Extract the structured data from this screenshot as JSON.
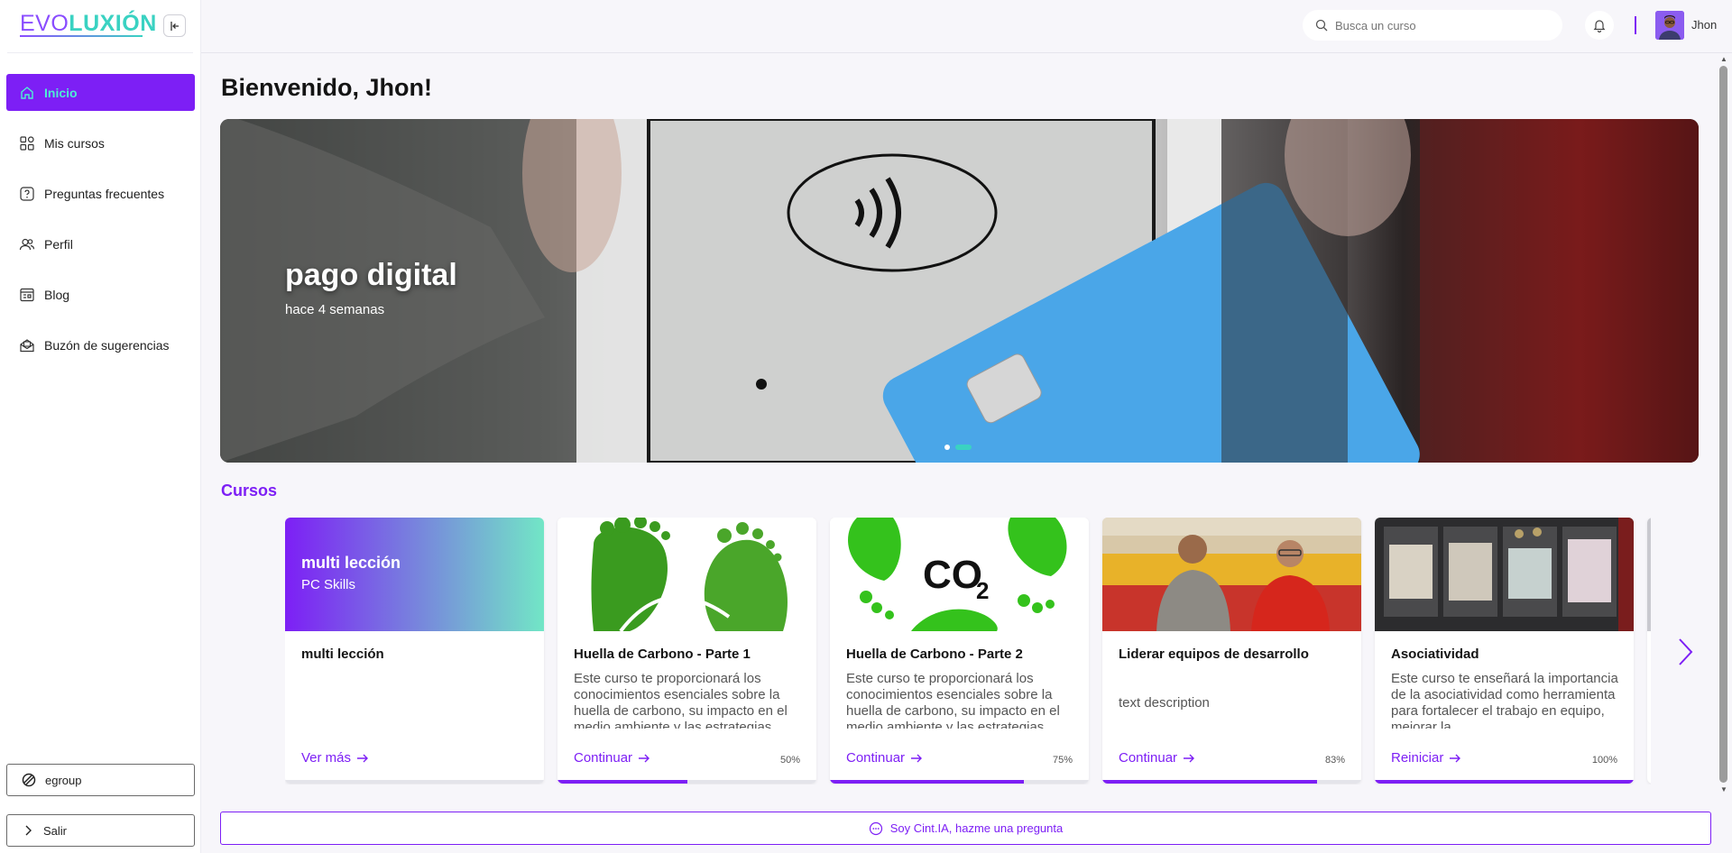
{
  "brand": {
    "logo_part1": "EVO",
    "logo_part2": "LUXIÓN"
  },
  "sidebar": {
    "items": [
      {
        "label": "Inicio",
        "icon": "home-icon",
        "active": true
      },
      {
        "label": "Mis cursos",
        "icon": "grid-icon"
      },
      {
        "label": "Preguntas frecuentes",
        "icon": "question-icon"
      },
      {
        "label": "Perfil",
        "icon": "users-icon"
      },
      {
        "label": "Blog",
        "icon": "blog-icon"
      },
      {
        "label": "Buzón de sugerencias",
        "icon": "mailbox-icon"
      }
    ],
    "org_label": "egroup",
    "logout_label": "Salir"
  },
  "header": {
    "search_placeholder": "Busca un curso",
    "user_name": "Jhon"
  },
  "main": {
    "welcome": "Bienvenido, Jhon!",
    "hero": {
      "title": "pago digital",
      "subtitle": "hace 4 semanas",
      "slides": 2,
      "active_slide": 2
    },
    "courses_title": "Cursos",
    "courses": [
      {
        "cover_title": "multi lección",
        "cover_subtitle": "PC Skills",
        "title": "multi lección",
        "description": "",
        "action": "Ver más",
        "progress": null
      },
      {
        "title": "Huella de Carbono - Parte 1",
        "description": "Este curso te proporcionará los conocimientos esenciales sobre la huella de carbono, su impacto en el medio ambiente y las estrategias",
        "action": "Continuar",
        "progress_label": "50%",
        "progress": 0.5
      },
      {
        "title": "Huella de Carbono - Parte 2",
        "description": "Este curso te proporcionará los conocimientos esenciales sobre la huella de carbono, su impacto en el medio ambiente y las estrategias",
        "action": "Continuar",
        "progress_label": "75%",
        "progress": 0.75
      },
      {
        "title": "Liderar equipos de desarrollo",
        "description": "text description",
        "action": "Continuar",
        "progress_label": "83%",
        "progress": 0.83
      },
      {
        "title": "Asociatividad",
        "description": "Este curso te enseñará la importancia de la asociatividad como herramienta para fortalecer el trabajo en equipo, mejorar la",
        "action": "Reiniciar",
        "progress_label": "100%",
        "progress": 1.0
      }
    ],
    "chat_label": "Soy Cint.IA, hazme una pregunta"
  },
  "colors": {
    "accent": "#7d1ff5",
    "teal": "#3ad2c2"
  }
}
